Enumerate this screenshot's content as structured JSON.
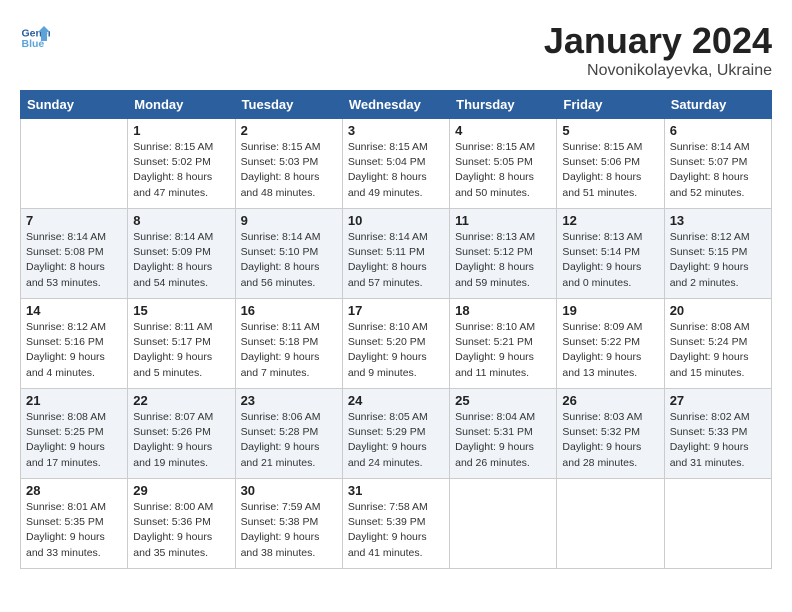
{
  "header": {
    "logo_line1": "General",
    "logo_line2": "Blue",
    "month": "January 2024",
    "location": "Novonikolayevka, Ukraine"
  },
  "weekdays": [
    "Sunday",
    "Monday",
    "Tuesday",
    "Wednesday",
    "Thursday",
    "Friday",
    "Saturday"
  ],
  "weeks": [
    [
      {
        "day": "",
        "info": ""
      },
      {
        "day": "1",
        "info": "Sunrise: 8:15 AM\nSunset: 5:02 PM\nDaylight: 8 hours\nand 47 minutes."
      },
      {
        "day": "2",
        "info": "Sunrise: 8:15 AM\nSunset: 5:03 PM\nDaylight: 8 hours\nand 48 minutes."
      },
      {
        "day": "3",
        "info": "Sunrise: 8:15 AM\nSunset: 5:04 PM\nDaylight: 8 hours\nand 49 minutes."
      },
      {
        "day": "4",
        "info": "Sunrise: 8:15 AM\nSunset: 5:05 PM\nDaylight: 8 hours\nand 50 minutes."
      },
      {
        "day": "5",
        "info": "Sunrise: 8:15 AM\nSunset: 5:06 PM\nDaylight: 8 hours\nand 51 minutes."
      },
      {
        "day": "6",
        "info": "Sunrise: 8:14 AM\nSunset: 5:07 PM\nDaylight: 8 hours\nand 52 minutes."
      }
    ],
    [
      {
        "day": "7",
        "info": "Sunrise: 8:14 AM\nSunset: 5:08 PM\nDaylight: 8 hours\nand 53 minutes."
      },
      {
        "day": "8",
        "info": "Sunrise: 8:14 AM\nSunset: 5:09 PM\nDaylight: 8 hours\nand 54 minutes."
      },
      {
        "day": "9",
        "info": "Sunrise: 8:14 AM\nSunset: 5:10 PM\nDaylight: 8 hours\nand 56 minutes."
      },
      {
        "day": "10",
        "info": "Sunrise: 8:14 AM\nSunset: 5:11 PM\nDaylight: 8 hours\nand 57 minutes."
      },
      {
        "day": "11",
        "info": "Sunrise: 8:13 AM\nSunset: 5:12 PM\nDaylight: 8 hours\nand 59 minutes."
      },
      {
        "day": "12",
        "info": "Sunrise: 8:13 AM\nSunset: 5:14 PM\nDaylight: 9 hours\nand 0 minutes."
      },
      {
        "day": "13",
        "info": "Sunrise: 8:12 AM\nSunset: 5:15 PM\nDaylight: 9 hours\nand 2 minutes."
      }
    ],
    [
      {
        "day": "14",
        "info": "Sunrise: 8:12 AM\nSunset: 5:16 PM\nDaylight: 9 hours\nand 4 minutes."
      },
      {
        "day": "15",
        "info": "Sunrise: 8:11 AM\nSunset: 5:17 PM\nDaylight: 9 hours\nand 5 minutes."
      },
      {
        "day": "16",
        "info": "Sunrise: 8:11 AM\nSunset: 5:18 PM\nDaylight: 9 hours\nand 7 minutes."
      },
      {
        "day": "17",
        "info": "Sunrise: 8:10 AM\nSunset: 5:20 PM\nDaylight: 9 hours\nand 9 minutes."
      },
      {
        "day": "18",
        "info": "Sunrise: 8:10 AM\nSunset: 5:21 PM\nDaylight: 9 hours\nand 11 minutes."
      },
      {
        "day": "19",
        "info": "Sunrise: 8:09 AM\nSunset: 5:22 PM\nDaylight: 9 hours\nand 13 minutes."
      },
      {
        "day": "20",
        "info": "Sunrise: 8:08 AM\nSunset: 5:24 PM\nDaylight: 9 hours\nand 15 minutes."
      }
    ],
    [
      {
        "day": "21",
        "info": "Sunrise: 8:08 AM\nSunset: 5:25 PM\nDaylight: 9 hours\nand 17 minutes."
      },
      {
        "day": "22",
        "info": "Sunrise: 8:07 AM\nSunset: 5:26 PM\nDaylight: 9 hours\nand 19 minutes."
      },
      {
        "day": "23",
        "info": "Sunrise: 8:06 AM\nSunset: 5:28 PM\nDaylight: 9 hours\nand 21 minutes."
      },
      {
        "day": "24",
        "info": "Sunrise: 8:05 AM\nSunset: 5:29 PM\nDaylight: 9 hours\nand 24 minutes."
      },
      {
        "day": "25",
        "info": "Sunrise: 8:04 AM\nSunset: 5:31 PM\nDaylight: 9 hours\nand 26 minutes."
      },
      {
        "day": "26",
        "info": "Sunrise: 8:03 AM\nSunset: 5:32 PM\nDaylight: 9 hours\nand 28 minutes."
      },
      {
        "day": "27",
        "info": "Sunrise: 8:02 AM\nSunset: 5:33 PM\nDaylight: 9 hours\nand 31 minutes."
      }
    ],
    [
      {
        "day": "28",
        "info": "Sunrise: 8:01 AM\nSunset: 5:35 PM\nDaylight: 9 hours\nand 33 minutes."
      },
      {
        "day": "29",
        "info": "Sunrise: 8:00 AM\nSunset: 5:36 PM\nDaylight: 9 hours\nand 35 minutes."
      },
      {
        "day": "30",
        "info": "Sunrise: 7:59 AM\nSunset: 5:38 PM\nDaylight: 9 hours\nand 38 minutes."
      },
      {
        "day": "31",
        "info": "Sunrise: 7:58 AM\nSunset: 5:39 PM\nDaylight: 9 hours\nand 41 minutes."
      },
      {
        "day": "",
        "info": ""
      },
      {
        "day": "",
        "info": ""
      },
      {
        "day": "",
        "info": ""
      }
    ]
  ]
}
